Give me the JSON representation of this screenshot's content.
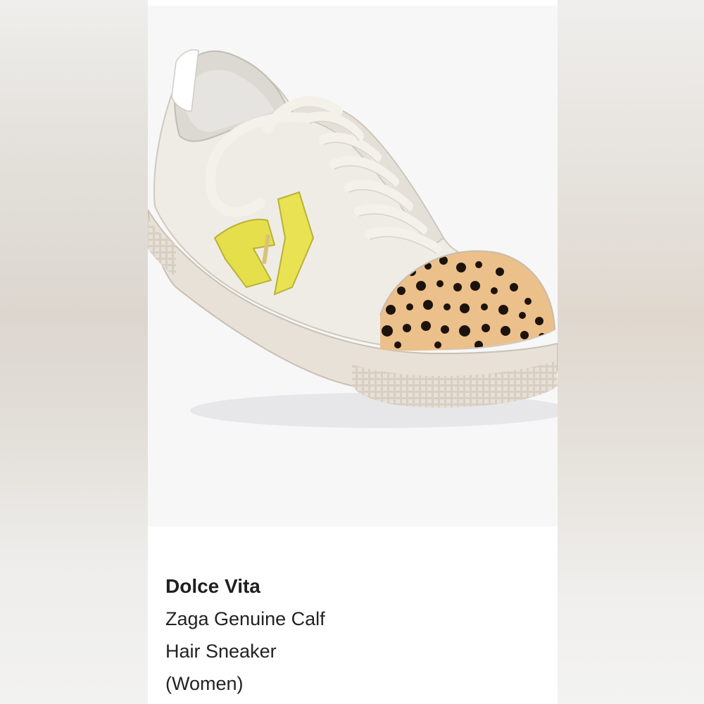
{
  "product": {
    "brand": "Dolce Vita",
    "name_line1": "Zaga Genuine Calf",
    "name_line2": "Hair Sneaker",
    "audience": "(Women)"
  },
  "image": {
    "subject": "sneaker-photo",
    "colors": {
      "upper": "#ece9e2",
      "accent": "#e6df4c",
      "leopard_base": "#e9bf86",
      "spots": "#1c130c",
      "sole": "#dcd3c8"
    }
  }
}
